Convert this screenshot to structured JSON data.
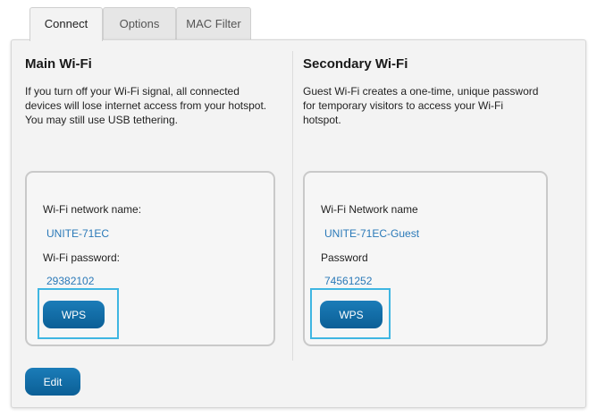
{
  "tabs": [
    {
      "label": "Connect",
      "active": true
    },
    {
      "label": "Options",
      "active": false
    },
    {
      "label": "MAC Filter",
      "active": false
    }
  ],
  "main_wifi": {
    "title": "Main Wi-Fi",
    "description_lines": [
      "If you turn off your Wi-Fi signal, all connected",
      "devices will lose internet access from your hotspot.",
      "You may still use USB tethering."
    ],
    "network_name_label": "Wi-Fi network name:",
    "network_name": "UNITE-71EC",
    "password_label": "Wi-Fi password:",
    "password": "29382102",
    "wps_label": "WPS"
  },
  "secondary_wifi": {
    "title": "Secondary Wi-Fi",
    "description_lines": [
      "Guest Wi-Fi creates a one-time, unique password",
      "for temporary visitors to access your Wi-Fi",
      "hotspot."
    ],
    "network_name_label": "Wi-Fi Network name",
    "network_name": "UNITE-71EC-Guest",
    "password_label": "Password",
    "password": "74561252",
    "wps_label": "WPS"
  },
  "edit_label": "Edit",
  "colors": {
    "accent": "#0f6ea8",
    "link_value": "#2a79b8",
    "highlight": "#3fb6e2",
    "panel_bg": "#f3f3f3"
  }
}
